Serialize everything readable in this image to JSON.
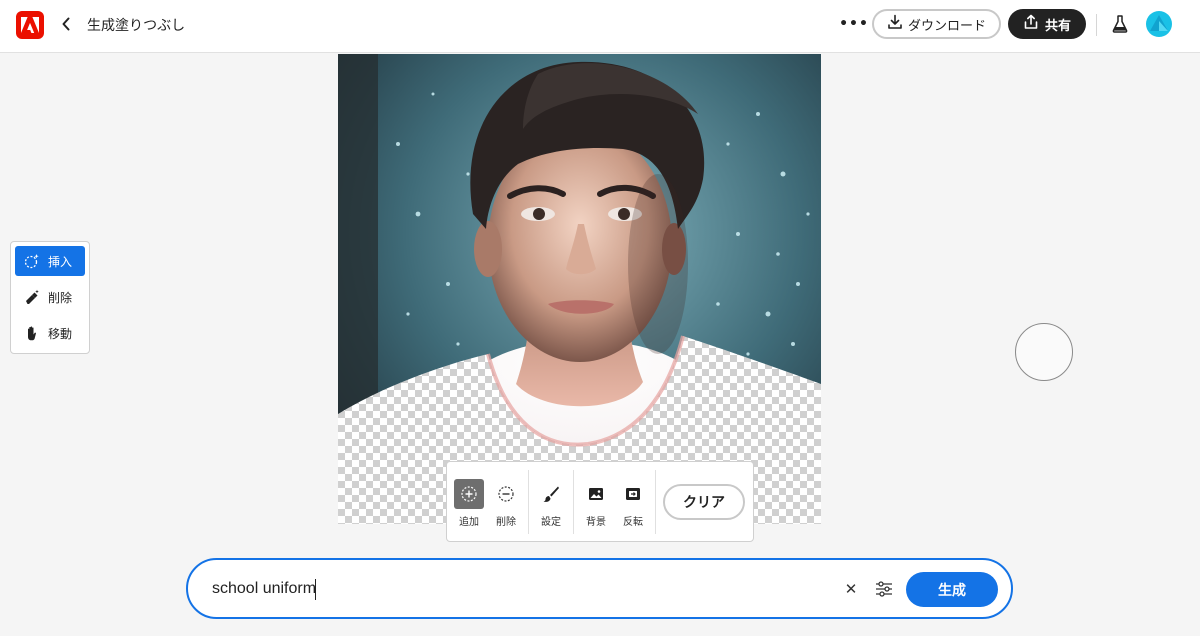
{
  "header": {
    "app_logo": "adobe-express-logo",
    "title": "生成塗りつぶし",
    "download_label": "ダウンロード",
    "share_label": "共有"
  },
  "left_tools": [
    {
      "label": "挿入",
      "icon": "insert-sparkle-icon",
      "active": true
    },
    {
      "label": "削除",
      "icon": "eraser-sparkle-icon",
      "active": false
    },
    {
      "label": "移動",
      "icon": "hand-icon",
      "active": false
    }
  ],
  "selection_toolbar": {
    "items": [
      {
        "label": "追加",
        "icon": "add-selection-icon",
        "active": true
      },
      {
        "label": "削除",
        "icon": "subtract-selection-icon",
        "active": false
      },
      {
        "label": "設定",
        "icon": "brush-icon",
        "active": false
      },
      {
        "label": "背景",
        "icon": "image-icon",
        "active": false
      },
      {
        "label": "反転",
        "icon": "invert-icon",
        "active": false
      }
    ],
    "clear_label": "クリア"
  },
  "prompt": {
    "value": "school uniform",
    "generate_label": "生成"
  },
  "colors": {
    "accent": "#1473e6",
    "brand": "#eb1000"
  }
}
